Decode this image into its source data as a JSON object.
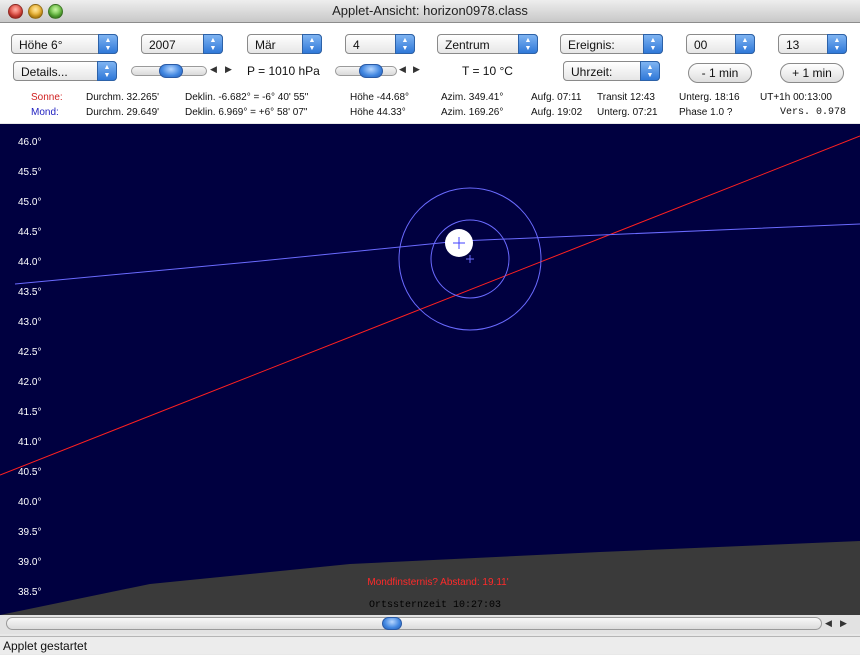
{
  "window": {
    "title": "Applet-Ansicht: horizon0978.class"
  },
  "controls": {
    "hoehe": "Höhe 6°",
    "year": "2007",
    "month": "Mär",
    "day": "4",
    "view": "Zentrum",
    "event": "Ereignis:",
    "hour": "00",
    "minute": "13",
    "details": "Details...",
    "uhrzeit": "Uhrzeit:",
    "minus_min": "- 1 min",
    "plus_min": "+ 1 min",
    "pressure": "P = 1010 hPa",
    "temperature": "T = 10 °C"
  },
  "info": {
    "sun": {
      "label": "Sonne:",
      "durchm": "Durchm. 32.265'",
      "deklin": "Deklin. -6.682° = -6° 40' 55\"",
      "hoehe": "Höhe -44.68°",
      "azim": "Azim. 349.41°",
      "aufg": "Aufg. 07:11",
      "transit": "Transit 12:43",
      "unterg": "Unterg. 18:16",
      "ut": "UT+1h  00:13:00"
    },
    "moon": {
      "label": "Mond:",
      "durchm": "Durchm. 29.649'",
      "deklin": "Deklin. 6.969° = +6° 58' 07\"",
      "hoehe": "Höhe 44.33°",
      "azim": "Azim. 169.26°",
      "aufg": "Aufg. 19:02",
      "unterg": "Unterg. 07:21",
      "phase": "Phase 1.0 ?",
      "version": "Vers. 0.978"
    }
  },
  "sky": {
    "altitude_labels": [
      "46.0°",
      "45.5°",
      "45.0°",
      "44.5°",
      "44.0°",
      "43.5°",
      "43.0°",
      "42.5°",
      "42.0°",
      "41.5°",
      "41.0°",
      "40.5°",
      "40.0°",
      "39.5°",
      "39.0°",
      "38.5°"
    ],
    "eclipse_text": "Mondfinsternis? Abstand: 19.11'",
    "sidereal_text": "Ortssternzeit 10:27:03",
    "colors": {
      "background": "#000040",
      "ground": "#3a3a3a",
      "ecliptic": "#ff2020",
      "moon_path": "#6a6aff",
      "shadow": "#6a6aff",
      "moon": "#ffffff",
      "alert": "#ff2a2a"
    }
  },
  "status": {
    "text": "Applet gestartet"
  }
}
